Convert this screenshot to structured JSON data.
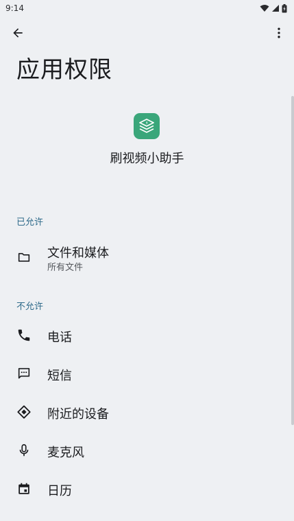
{
  "status_bar": {
    "time": "9:14"
  },
  "header": {
    "title": "应用权限"
  },
  "app": {
    "name": "刷视频小助手",
    "icon_color": "#3aa67a"
  },
  "sections": {
    "allowed": {
      "header": "已允许",
      "items": [
        {
          "label": "文件和媒体",
          "sub": "所有文件",
          "icon": "folder-icon"
        }
      ]
    },
    "denied": {
      "header": "不允许",
      "items": [
        {
          "label": "电话",
          "icon": "phone-icon"
        },
        {
          "label": "短信",
          "icon": "sms-icon"
        },
        {
          "label": "附近的设备",
          "icon": "nearby-devices-icon"
        },
        {
          "label": "麦克风",
          "icon": "microphone-icon"
        },
        {
          "label": "日历",
          "icon": "calendar-icon"
        }
      ]
    }
  },
  "colors": {
    "background": "#eef0f3",
    "section_header": "#2e6a8a",
    "text": "#1b1c1f"
  }
}
